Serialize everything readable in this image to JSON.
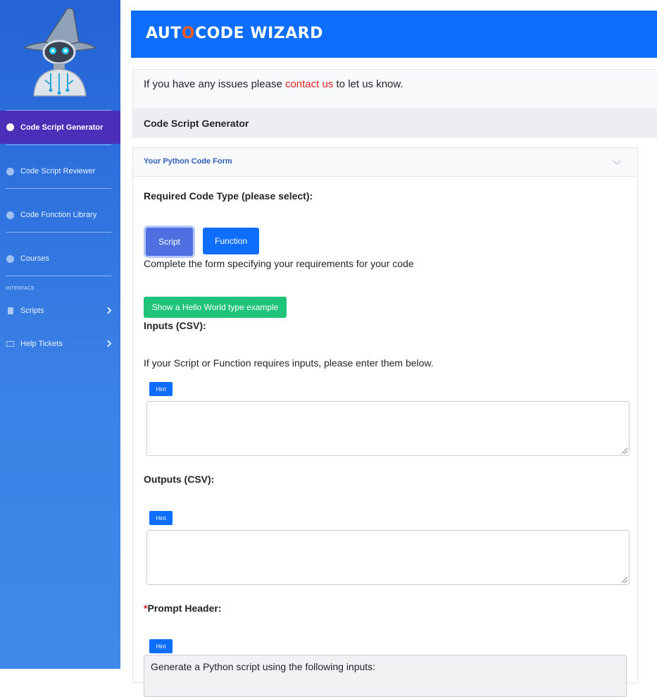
{
  "app": {
    "title_pre": "AUT",
    "title_o": "O",
    "title_post": "CODE WIZARD"
  },
  "sidebar": {
    "items": [
      {
        "label": "Code Script Generator"
      },
      {
        "label": "Code Script Reviewer"
      },
      {
        "label": "Code Function Library"
      },
      {
        "label": "Courses"
      }
    ],
    "section_heading": "INTERFACE",
    "collapsibles": [
      {
        "label": "Scripts"
      },
      {
        "label": "Help Tickets"
      }
    ]
  },
  "info": {
    "pre_link": "If you have any issues please ",
    "link": "contact us",
    "post_link": " to let us know.",
    "section_title": "Code Script Generator"
  },
  "form": {
    "header": "Your Python Code Form",
    "code_type_label": "Required Code Type (please select):",
    "script_button": "Script",
    "function_button": "Function",
    "instructions": "Complete the form specifying your requirements for your code",
    "example_button": "Show a Hello World type example",
    "inputs_label": "Inputs (CSV):",
    "inputs_help": "If your Script or Function requires inputs, please enter them below.",
    "hint_label": "Hint",
    "outputs_label": "Outputs (CSV):",
    "required_marker": "*",
    "prompt_header_label": "Prompt Header:",
    "prompt_header_value": "Generate a Python script using the following inputs:"
  },
  "colors": {
    "primary": "#0d6efd",
    "sidebar": "#2463d6",
    "active_item": "#4b2fb8",
    "success": "#20c37a",
    "link_red": "#e02424",
    "logo_o": "#ff5a1f"
  }
}
